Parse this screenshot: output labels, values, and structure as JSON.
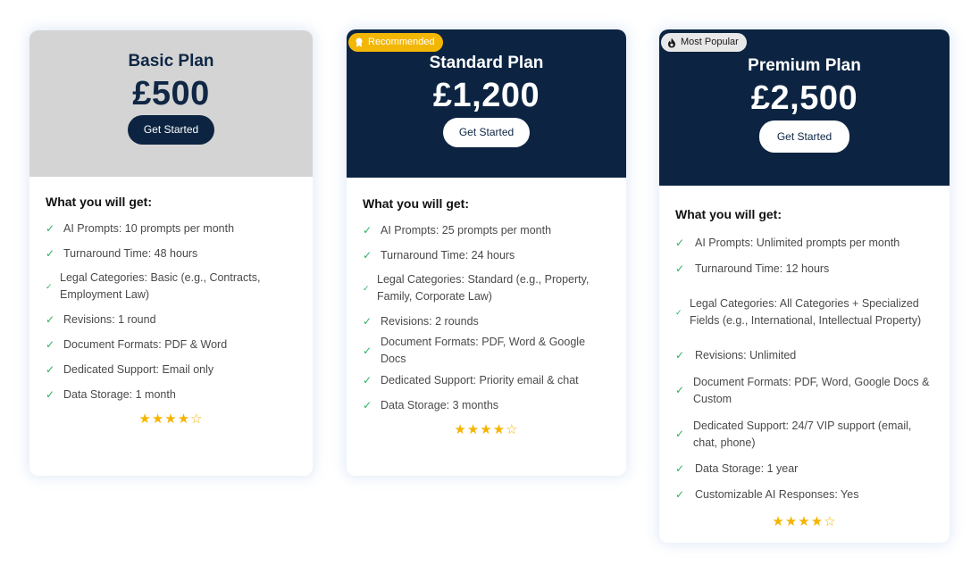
{
  "plans": [
    {
      "title": "Basic Plan",
      "price": "£500",
      "cta": "Get Started",
      "badge": null,
      "features_heading": "What you will get:",
      "features": [
        "AI Prompts: 10 prompts per month",
        "Turnaround Time: 48 hours",
        "Legal Categories: Basic (e.g., Contracts, Employment Law)",
        "Revisions: 1 round",
        "Document Formats: PDF & Word",
        "Dedicated Support: Email only",
        "Data Storage: 1 month"
      ],
      "rating": 4,
      "rating_max": 5
    },
    {
      "title": "Standard Plan",
      "price": "£1,200",
      "cta": "Get Started",
      "badge": "Recommended",
      "features_heading": "What you will get:",
      "features": [
        "AI Prompts: 25 prompts per month",
        "Turnaround Time: 24 hours",
        "Legal Categories: Standard (e.g., Property, Family, Corporate Law)",
        "Revisions: 2 rounds",
        "Document Formats: PDF, Word & Google Docs",
        "Dedicated Support: Priority email & chat",
        "Data Storage: 3 months"
      ],
      "rating": 4,
      "rating_max": 5
    },
    {
      "title": "Premium Plan",
      "price": "£2,500",
      "cta": "Get Started",
      "badge": "Most Popular",
      "features_heading": "What you will get:",
      "features": [
        "AI Prompts: Unlimited prompts per month",
        "Turnaround Time: 12 hours",
        "Legal Categories: All Categories + Specialized Fields (e.g., International, Intellectual Property)",
        "Revisions: Unlimited",
        "Document Formats: PDF, Word, Google Docs & Custom",
        "Dedicated Support: 24/7 VIP support (email, chat, phone)",
        "Data Storage: 1 year",
        "Customizable AI Responses: Yes"
      ],
      "rating": 4,
      "rating_max": 5
    }
  ],
  "icons": {
    "check": "check-icon",
    "star_filled": "star-filled-icon",
    "star_empty": "star-empty-icon",
    "recommended": "award-ribbon-icon",
    "most_popular": "flame-icon"
  },
  "colors": {
    "navy": "#0c2442",
    "light_header": "#d4d4d4",
    "check_green": "#2eb062",
    "star_yellow": "#f5b400",
    "recommended_badge": "#f2b705"
  }
}
